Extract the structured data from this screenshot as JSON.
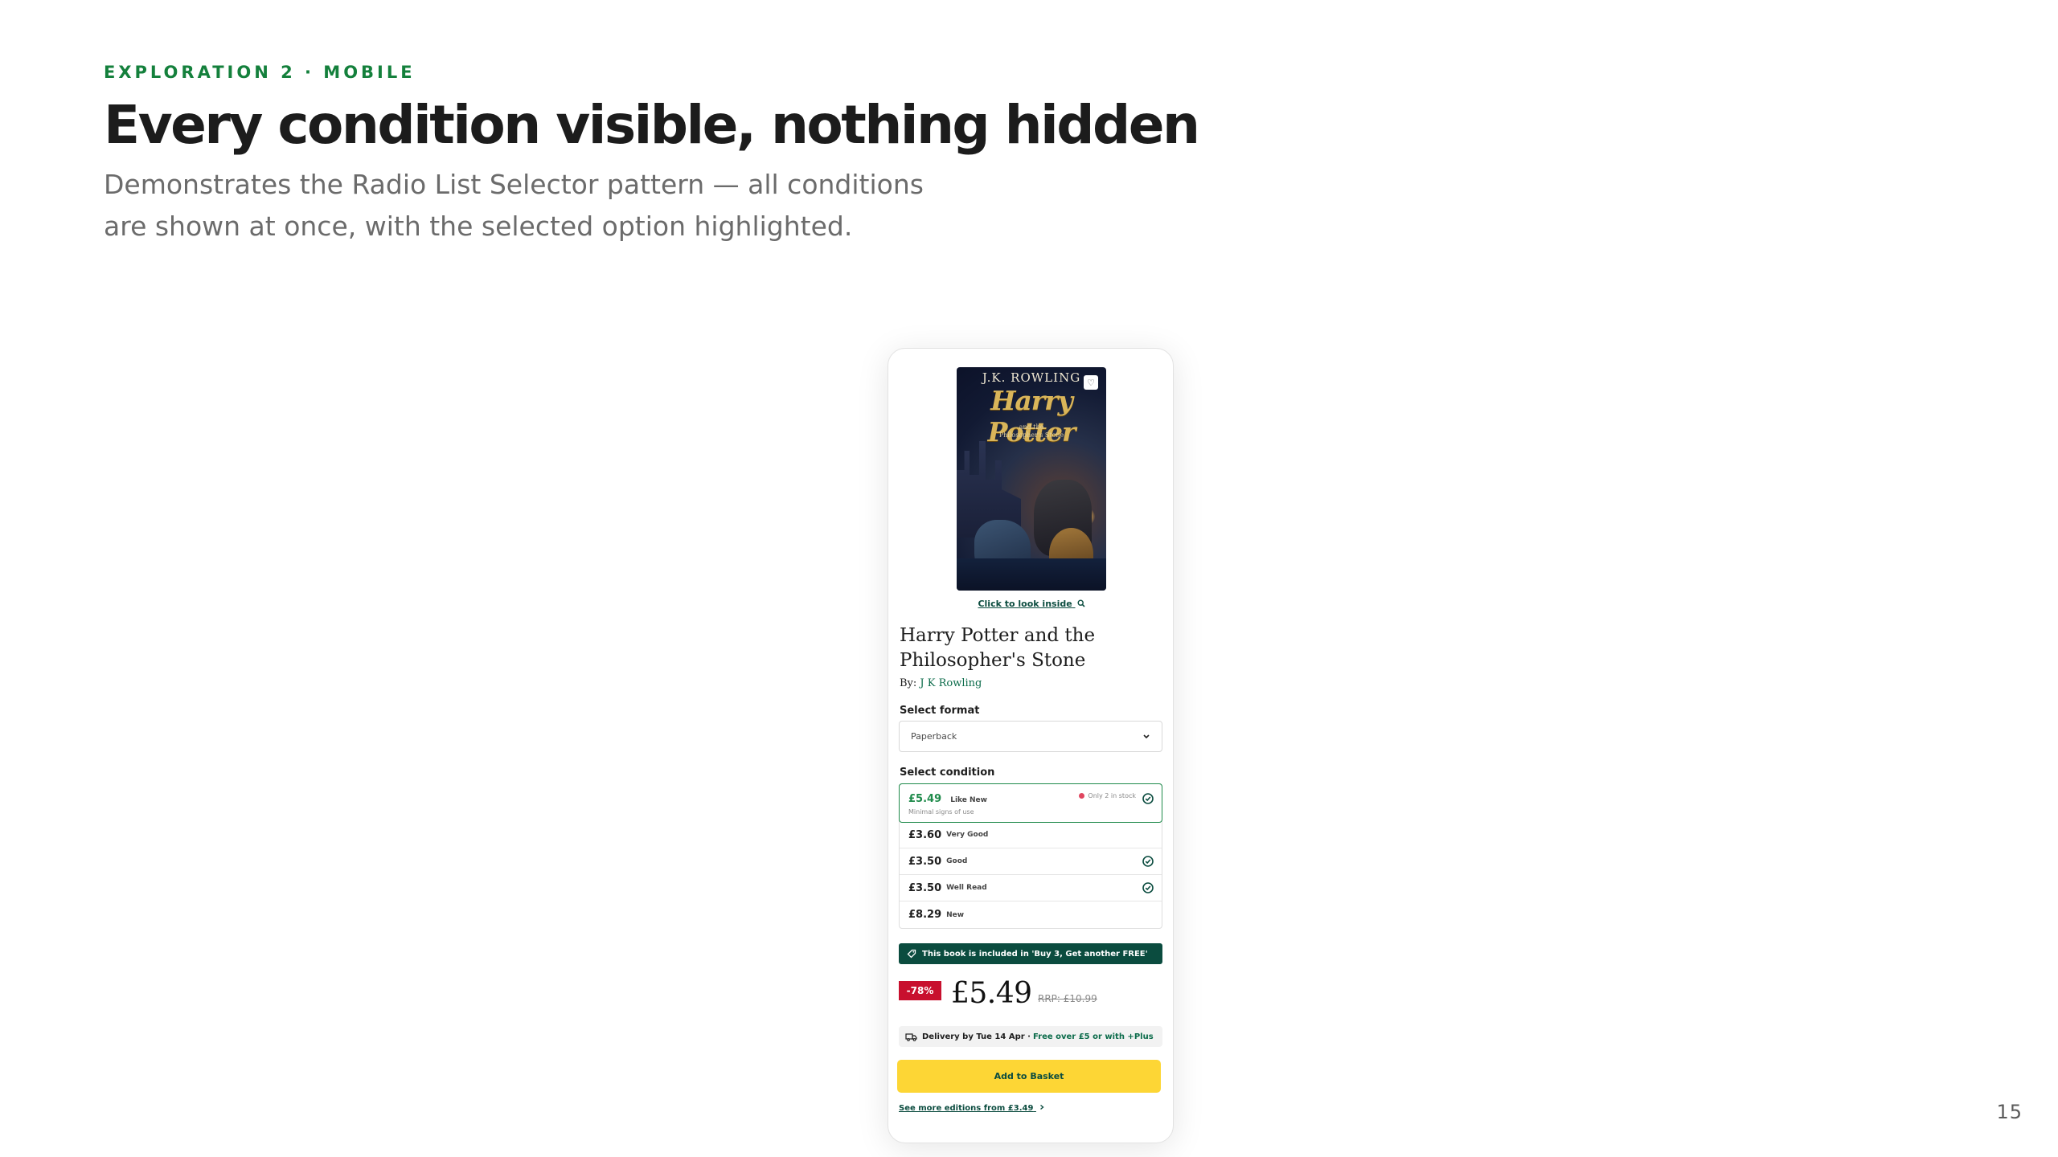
{
  "slide": {
    "eyebrow": "EXPLORATION 2 · MOBILE",
    "headline": "Every condition visible, nothing hidden",
    "subhead_line1": "Demonstrates the Radio List Selector pattern — all conditions",
    "subhead_line2": "are shown at once, with the selected option highlighted.",
    "page_number": "15"
  },
  "product": {
    "cover": {
      "author": "J.K. ROWLING",
      "title": "Harry Potter",
      "subtitle_line1": "and the",
      "subtitle_line2": "Philosopher's Stone",
      "favourite_icon": "heart-icon"
    },
    "look_inside": "Click to look inside",
    "look_inside_icon": "search-icon",
    "title_line1": "Harry Potter and the",
    "title_line2": "Philosopher's Stone",
    "by_label": "By:",
    "author": "J K Rowling",
    "format_label": "Select format",
    "format_value": "Paperback",
    "condition_label": "Select condition",
    "conditions": [
      {
        "price": "£5.49",
        "name": "Like New",
        "desc": "Minimal signs of use",
        "stock": "Only 2 in stock",
        "selected": true,
        "check": true
      },
      {
        "price": "£3.60",
        "name": "Very Good",
        "selected": false,
        "check": false
      },
      {
        "price": "£3.50",
        "name": "Good",
        "selected": false,
        "check": true
      },
      {
        "price": "£3.50",
        "name": "Well Read",
        "selected": false,
        "check": true
      },
      {
        "price": "£8.29",
        "name": "New",
        "selected": false,
        "check": false
      }
    ],
    "promo": "This book is included in 'Buy 3, Get another FREE'",
    "discount": "-78%",
    "price": "£5.49",
    "rrp": "RRP: £10.99",
    "delivery_main": "Delivery by Tue 14 Apr ·",
    "delivery_free": "Free over £5 or with +Plus",
    "add_to_basket": "Add to Basket",
    "more_editions": "See more editions from £3.49"
  },
  "colors": {
    "accent_green": "#14803c",
    "dark_green": "#0b4c3f",
    "selected_border": "#1e8a4a",
    "discount_red": "#c8102e",
    "basket_yellow": "#fdd635"
  }
}
